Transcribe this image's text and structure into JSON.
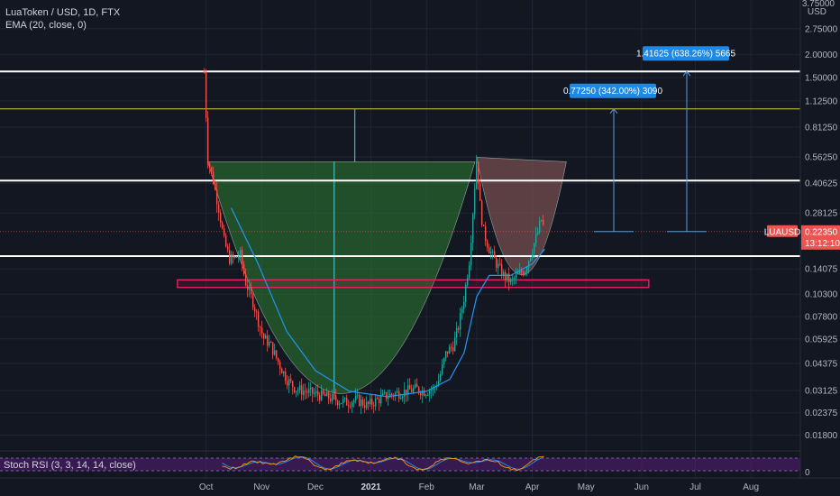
{
  "legend": {
    "symbol": "LuaToken / USD, 1D, FTX",
    "ema": "EMA (20, close, 0)",
    "stoch": "Stoch RSI (3, 3, 14, 14, close)"
  },
  "price_axis": {
    "unit": "USD",
    "top_tick": "3.75000",
    "ticks": [
      "2.75000",
      "2.00000",
      "1.50000",
      "1.12500",
      "0.81250",
      "0.56250",
      "0.40625",
      "0.28125",
      "0.14075",
      "0.10300",
      "0.07800",
      "0.05925",
      "0.04375",
      "0.03125",
      "0.02375",
      "0.01800"
    ]
  },
  "stoch_axis": {
    "zero": "0"
  },
  "time_axis": {
    "labels": [
      "Oct",
      "Nov",
      "Dec",
      "2021",
      "Feb",
      "Mar",
      "Apr",
      "May",
      "Jun",
      "Jul",
      "Aug"
    ],
    "bold": "2021"
  },
  "price_tag": {
    "symbol": "LUAUSD",
    "price": "0.22350",
    "countdown": "13:12:10"
  },
  "measure_boxes": [
    {
      "text": "1.41625 (638.26%) 5665"
    },
    {
      "text": "0.77250 (342.00%) 3090"
    }
  ],
  "colors": {
    "background": "#131722",
    "up": "#26a69a",
    "down": "#ef5350",
    "ema": "#2196f3",
    "level_white": "#ffffff",
    "level_yellow": "#d6cc3a",
    "cup_green": "#2e7d32",
    "cup_red": "#8d5a5a",
    "zone_border": "#e91e63",
    "stoch_fill": "#7b1fa2",
    "stoch_k": "#ff9800",
    "stoch_d": "#2196f3",
    "label_box": "#1e88e5",
    "price_tag": "#ef5350"
  },
  "chart_data": {
    "type": "candlestick",
    "title": "LuaToken / USD, 1D, FTX",
    "y_scale": "log",
    "ylim": [
      0.0155,
      3.75
    ],
    "indicators": [
      "EMA (20, close, 0)",
      "Stoch RSI (3, 3, 14, 14, close)"
    ],
    "horizontal_levels": [
      1.62,
      1.02,
      0.42,
      0.165
    ],
    "support_zone": [
      0.112,
      0.123
    ],
    "last_price": 0.2235,
    "measures": [
      {
        "from": 0.2235,
        "to": 1.62,
        "change": "1.41625 (638.26%) 5665"
      },
      {
        "from": 0.2235,
        "to": 1.02,
        "change": "0.77250 (342.00%) 3090"
      }
    ],
    "price_path": [
      [
        "2020-09-30",
        1.6
      ],
      [
        "2020-10-01",
        0.95
      ],
      [
        "2020-10-02",
        0.55
      ],
      [
        "2020-10-05",
        0.42
      ],
      [
        "2020-10-08",
        0.3
      ],
      [
        "2020-10-11",
        0.2
      ],
      [
        "2020-10-14",
        0.16
      ],
      [
        "2020-10-17",
        0.16
      ],
      [
        "2020-10-20",
        0.17
      ],
      [
        "2020-10-23",
        0.12
      ],
      [
        "2020-10-27",
        0.095
      ],
      [
        "2020-10-30",
        0.075
      ],
      [
        "2020-11-02",
        0.06
      ],
      [
        "2020-11-06",
        0.055
      ],
      [
        "2020-11-10",
        0.045
      ],
      [
        "2020-11-15",
        0.036
      ],
      [
        "2020-11-20",
        0.032
      ],
      [
        "2020-11-25",
        0.031
      ],
      [
        "2020-12-01",
        0.03
      ],
      [
        "2020-12-07",
        0.029
      ],
      [
        "2020-12-12",
        0.028
      ],
      [
        "2020-12-18",
        0.027
      ],
      [
        "2020-12-24",
        0.028
      ],
      [
        "2020-12-30",
        0.026
      ],
      [
        "2021-01-02",
        0.027
      ],
      [
        "2021-01-08",
        0.029
      ],
      [
        "2021-01-14",
        0.03
      ],
      [
        "2021-01-20",
        0.031
      ],
      [
        "2021-01-26",
        0.032
      ],
      [
        "2021-01-31",
        0.031
      ],
      [
        "2021-02-05",
        0.032
      ],
      [
        "2021-02-08",
        0.036
      ],
      [
        "2021-02-12",
        0.05
      ],
      [
        "2021-02-16",
        0.055
      ],
      [
        "2021-02-19",
        0.07
      ],
      [
        "2021-02-22",
        0.1
      ],
      [
        "2021-02-25",
        0.16
      ],
      [
        "2021-02-27",
        0.3
      ],
      [
        "2021-03-01",
        0.56
      ],
      [
        "2021-03-03",
        0.3
      ],
      [
        "2021-03-05",
        0.22
      ],
      [
        "2021-03-08",
        0.18
      ],
      [
        "2021-03-12",
        0.15
      ],
      [
        "2021-03-16",
        0.13
      ],
      [
        "2021-03-20",
        0.12
      ],
      [
        "2021-03-24",
        0.13
      ],
      [
        "2021-03-28",
        0.14
      ],
      [
        "2021-04-01",
        0.18
      ],
      [
        "2021-04-04",
        0.22
      ],
      [
        "2021-04-06",
        0.26
      ],
      [
        "2021-04-08",
        0.2235
      ]
    ],
    "ema_path": [
      [
        "2020-10-15",
        0.3
      ],
      [
        "2020-10-30",
        0.15
      ],
      [
        "2020-11-15",
        0.065
      ],
      [
        "2020-12-01",
        0.04
      ],
      [
        "2020-12-20",
        0.031
      ],
      [
        "2021-01-10",
        0.029
      ],
      [
        "2021-02-01",
        0.031
      ],
      [
        "2021-02-14",
        0.036
      ],
      [
        "2021-02-22",
        0.05
      ],
      [
        "2021-03-01",
        0.1
      ],
      [
        "2021-03-08",
        0.13
      ],
      [
        "2021-03-20",
        0.13
      ],
      [
        "2021-04-01",
        0.15
      ],
      [
        "2021-04-08",
        0.18
      ]
    ]
  }
}
